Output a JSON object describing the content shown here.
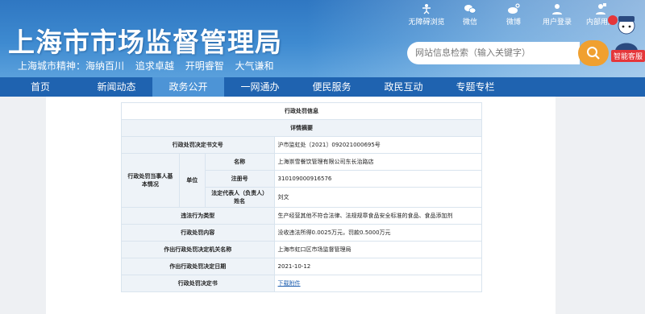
{
  "header": {
    "site_title": "上海市市场监督管理局",
    "slogan": [
      "上海城市精神：海纳百川",
      "追求卓越",
      "开明睿智",
      "大气谦和"
    ],
    "top_links": [
      {
        "label": "无障碍浏览",
        "icon": "accessibility-icon"
      },
      {
        "label": "微信",
        "icon": "wechat-icon"
      },
      {
        "label": "微博",
        "icon": "weibo-icon"
      },
      {
        "label": "用户登录",
        "icon": "user-icon"
      },
      {
        "label": "内部用户",
        "icon": "internal-user-icon"
      }
    ],
    "search_placeholder": "网站信息检索（输入关键字）",
    "service_label": "智能客服"
  },
  "nav": {
    "items": [
      "首页",
      "新闻动态",
      "政务公开",
      "一网通办",
      "便民服务",
      "政民互动",
      "专题专栏"
    ],
    "active_index": 2
  },
  "record": {
    "title": "行政处罚信息",
    "subtitle": "详情摘要",
    "decision_no_label": "行政处罚决定书文号",
    "decision_no": "沪市监虹处〔2021〕092021000695号",
    "party_section_label": "行政处罚当事人基本情况",
    "party_type_label": "单位",
    "name_label": "名称",
    "name": "上海崇雪餐饮管理有限公司东长治路店",
    "reg_no_label": "注册号",
    "reg_no": "310109000916576",
    "legal_rep_label": "法定代表人（负责人）姓名",
    "legal_rep": "刘文",
    "violation_type_label": "违法行为类型",
    "violation_type": "生产经营其他不符合法律、法规规章食品安全标准的食品、食品添加剂",
    "penalty_label": "行政处罚内容",
    "penalty": "没收违法所得0.0025万元，罚款0.5000万元",
    "authority_label": "作出行政处罚决定机关名称",
    "authority": "上海市虹口区市场监督管理局",
    "date_label": "作出行政处罚决定日期",
    "date": "2021-10-12",
    "document_label": "行政处罚决定书",
    "document_link": "下载附件"
  }
}
